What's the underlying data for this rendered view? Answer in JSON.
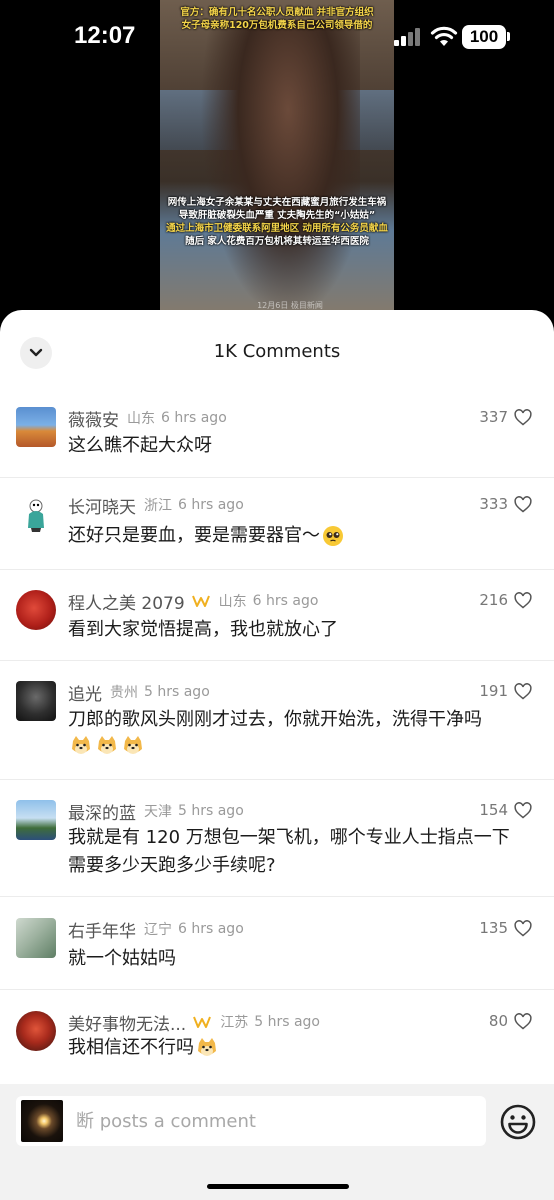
{
  "status_bar": {
    "time": "12:07",
    "battery": "100"
  },
  "video": {
    "caption_top": [
      "官方：确有几十名公职人员献血 并非官方组织",
      "女子母亲称120万包机费系自己公司领导借的"
    ],
    "caption_mid": [
      "网传上海女子余某某与丈夫在西藏蜜月旅行发生车祸",
      "导致肝脏破裂失血严重 丈夫陶先生的“小姑姑”",
      "通过上海市卫健委联系阿里地区 动用所有公务员献血",
      "随后 家人花费百万包机将其转运至华西医院"
    ],
    "watermark": "12月6日 极目新闻"
  },
  "sheet": {
    "title": "1K Comments"
  },
  "comments": [
    {
      "username": "薇薇安",
      "location": "山东",
      "time": "6 hrs ago",
      "likes": "337",
      "text": "这么瞧不起大众呀"
    },
    {
      "username": "长河晓天",
      "location": "浙江",
      "time": "6 hrs ago",
      "likes": "333",
      "text": "还好只是要血，要是需要器官～"
    },
    {
      "username": "程人之美 2079",
      "location": "山东",
      "time": "6 hrs ago",
      "likes": "216",
      "text": "看到大家觉悟提高，我也就放心了"
    },
    {
      "username": "追光",
      "location": "贵州",
      "time": "5 hrs ago",
      "likes": "191",
      "text": "刀郎的歌风头刚刚才过去，你就开始洗，洗得干净吗"
    },
    {
      "username": "最深的蓝",
      "location": "天津",
      "time": "5 hrs ago",
      "likes": "154",
      "text": "我就是有 120 万想包一架飞机，哪个专业人士指点一下需要多少天跑多少手续呢?"
    },
    {
      "username": "右手年华",
      "location": "辽宁",
      "time": "6 hrs ago",
      "likes": "135",
      "text": "就一个姑姑吗"
    },
    {
      "username": "美好事物无法...",
      "location": "江苏",
      "time": "5 hrs ago",
      "likes": "80",
      "text": "我相信还不行吗"
    }
  ],
  "input": {
    "placeholder": "断 posts a comment"
  },
  "colors": {
    "caption_yellow": "#f5d54a",
    "badge_gold": "#f0b020",
    "heart_outline": "#555555"
  }
}
